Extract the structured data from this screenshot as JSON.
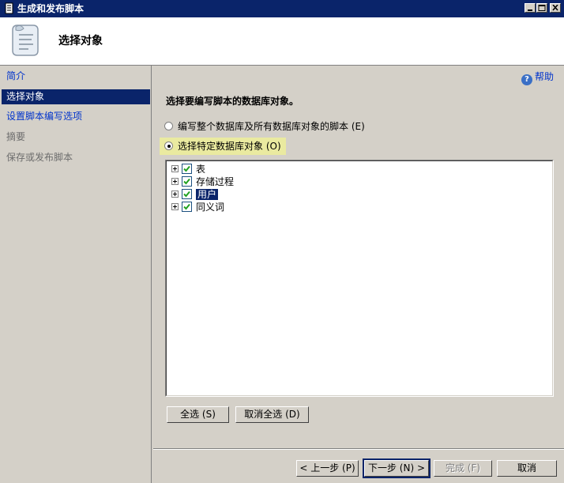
{
  "window": {
    "title": "生成和发布脚本"
  },
  "header": {
    "title": "选择对象"
  },
  "nav": {
    "items": [
      {
        "label": "简介",
        "state": "link"
      },
      {
        "label": "选择对象",
        "state": "selected"
      },
      {
        "label": "设置脚本编写选项",
        "state": "link"
      },
      {
        "label": "摘要",
        "state": "disabled"
      },
      {
        "label": "保存或发布脚本",
        "state": "disabled"
      }
    ]
  },
  "main": {
    "help_label": "帮助",
    "prompt": "选择要编写脚本的数据库对象。",
    "options": {
      "all_objects": "编写整个数据库及所有数据库对象的脚本 (E)",
      "specific_objects": "选择特定数据库对象 (O)"
    },
    "selected_option": "specific_objects",
    "tree": [
      {
        "label": "表",
        "checked": true
      },
      {
        "label": "存储过程",
        "checked": true
      },
      {
        "label": "用户",
        "checked": true,
        "selected": true
      },
      {
        "label": "同义词",
        "checked": true
      }
    ],
    "select_all_label": "全选 (S)",
    "deselect_all_label": "取消全选 (D)"
  },
  "footer": {
    "prev_label": "< 上一步 (P)",
    "next_label": "下一步 (N) >",
    "finish_label": "完成 (F)",
    "cancel_label": "取消"
  },
  "colors": {
    "titlebar": "#0a246a",
    "nav_selected": "#0a246a",
    "link": "#0033cc",
    "highlight": "#eaeaa0"
  }
}
